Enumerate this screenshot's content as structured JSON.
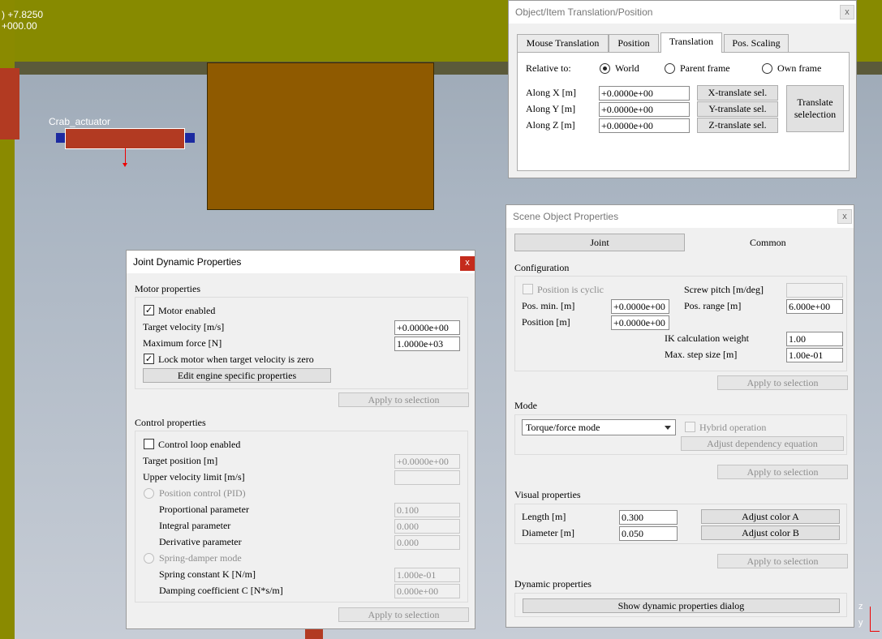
{
  "viewport": {
    "coord_line1": ") +7.8250",
    "coord_line2": "+000.00",
    "object_label": "Crab_actuator",
    "axis_z": "z",
    "axis_y": "y"
  },
  "translation_dialog": {
    "title": "Object/Item Translation/Position",
    "close": "x",
    "tabs": [
      "Mouse Translation",
      "Position",
      "Translation",
      "Pos. Scaling"
    ],
    "relative_to_label": "Relative to:",
    "options": [
      "World",
      "Parent frame",
      "Own frame"
    ],
    "rows": [
      {
        "label": "Along X [m]",
        "value": "+0.0000e+00",
        "button": "X-translate sel."
      },
      {
        "label": "Along Y [m]",
        "value": "+0.0000e+00",
        "button": "Y-translate sel."
      },
      {
        "label": "Along Z [m]",
        "value": "+0.0000e+00",
        "button": "Z-translate sel."
      }
    ],
    "translate_button_l1": "Translate",
    "translate_button_l2": "selelection"
  },
  "joint_dialog": {
    "title": "Joint Dynamic Properties",
    "close": "x",
    "motor_section": "Motor properties",
    "motor_enabled": "Motor enabled",
    "target_velocity_label": "Target velocity [m/s]",
    "target_velocity": "+0.0000e+00",
    "max_force_label": "Maximum force [N]",
    "max_force": "1.0000e+03",
    "lock_motor": "Lock motor when target velocity is zero",
    "edit_engine": "Edit engine specific properties",
    "apply": "Apply to selection",
    "control_section": "Control properties",
    "control_loop": "Control loop enabled",
    "target_position_label": "Target position [m]",
    "target_position": "+0.0000e+00",
    "upper_velocity_label": "Upper velocity limit [m/s]",
    "upper_velocity": "",
    "position_control": "Position control (PID)",
    "proportional_label": "Proportional parameter",
    "proportional": "0.100",
    "integral_label": "Integral parameter",
    "integral": "0.000",
    "derivative_label": "Derivative parameter",
    "derivative": "0.000",
    "spring_damper": "Spring-damper mode",
    "spring_k_label": "Spring constant K [N/m]",
    "spring_k": "1.000e-01",
    "damping_c_label": "Damping coefficient C [N*s/m]",
    "damping_c": "0.000e+00"
  },
  "scene_dialog": {
    "title": "Scene Object Properties",
    "close": "x",
    "tab_joint": "Joint",
    "tab_common": "Common",
    "configuration": "Configuration",
    "position_cyclic": "Position is cyclic",
    "screw_pitch_label": "Screw pitch [m/deg]",
    "screw_pitch": "",
    "pos_min_label": "Pos. min. [m]",
    "pos_min": "+0.0000e+00",
    "pos_range_label": "Pos. range [m]",
    "pos_range": "6.000e+00",
    "position_label": "Position [m]",
    "position": "+0.0000e+00",
    "ik_weight_label": "IK calculation weight",
    "ik_weight": "1.00",
    "max_step_label": "Max. step size [m]",
    "max_step": "1.00e-01",
    "apply": "Apply to selection",
    "mode": "Mode",
    "mode_value": "Torque/force mode",
    "hybrid": "Hybrid operation",
    "adjust_dependency": "Adjust dependency equation",
    "visual": "Visual properties",
    "length_label": "Length [m]",
    "length": "0.300",
    "diameter_label": "Diameter [m]",
    "diameter": "0.050",
    "color_a": "Adjust color A",
    "color_b": "Adjust color B",
    "dynamic": "Dynamic properties",
    "show_dynamic": "Show dynamic properties dialog"
  }
}
